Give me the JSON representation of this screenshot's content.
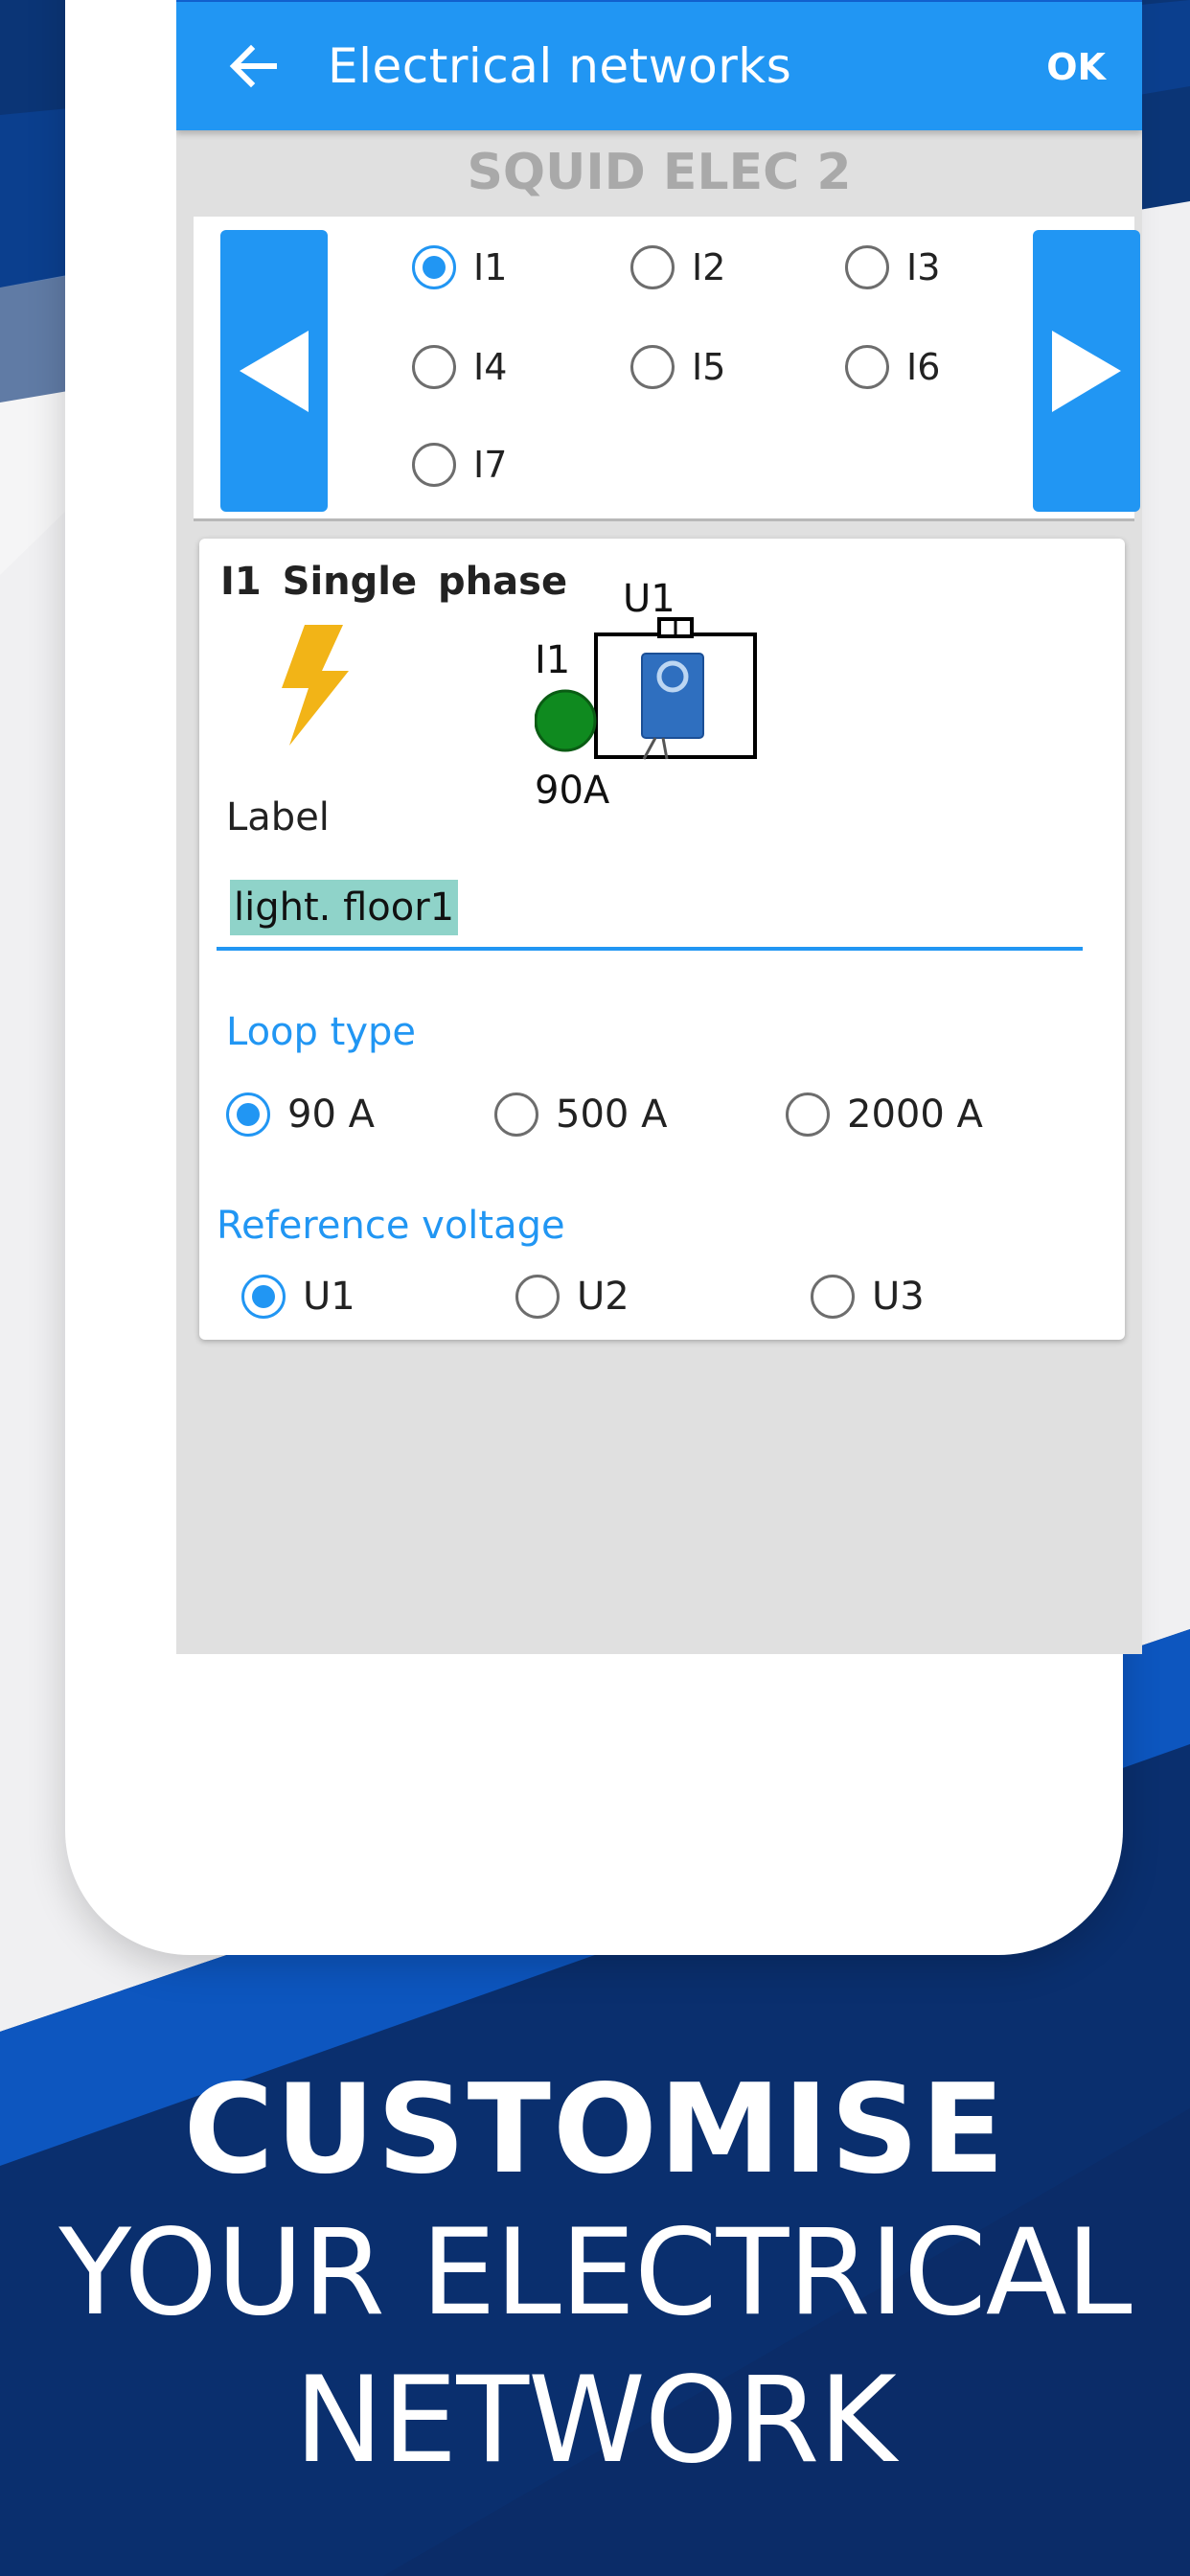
{
  "appbar": {
    "title": "Electrical networks",
    "ok_label": "OK"
  },
  "device_name": "SQUID ELEC 2",
  "inputs": [
    {
      "label": "I1",
      "checked": true
    },
    {
      "label": "I2",
      "checked": false
    },
    {
      "label": "I3",
      "checked": false
    },
    {
      "label": "I4",
      "checked": false
    },
    {
      "label": "I5",
      "checked": false
    },
    {
      "label": "I6",
      "checked": false
    },
    {
      "label": "I7",
      "checked": false
    }
  ],
  "detail": {
    "title": "I1  Single phase",
    "diagram": {
      "voltage": "U1",
      "input": "I1",
      "loop": "90A"
    },
    "label_caption": "Label",
    "label_value": "light. floor1"
  },
  "loop_type": {
    "title": "Loop type",
    "options": [
      {
        "label": "90 A",
        "checked": true
      },
      {
        "label": "500 A",
        "checked": false
      },
      {
        "label": "2000 A",
        "checked": false
      }
    ]
  },
  "reference_voltage": {
    "title": "Reference voltage",
    "options": [
      {
        "label": "U1",
        "checked": true
      },
      {
        "label": "U2",
        "checked": false
      },
      {
        "label": "U3",
        "checked": false
      }
    ]
  },
  "tagline": {
    "line1": "CUSTOMISE",
    "line2": "YOUR ELECTRICAL",
    "line3": "NETWORK"
  },
  "colors": {
    "primary": "#2196f3",
    "status_bar": "#1261cf",
    "navy": "#0a2f6e",
    "led": "#0f8a1f",
    "bolt": "#f2b417"
  },
  "icons": [
    "back-arrow-icon",
    "left-triangle-icon",
    "right-triangle-icon",
    "lightning-bolt-icon",
    "current-sensor-icon"
  ]
}
